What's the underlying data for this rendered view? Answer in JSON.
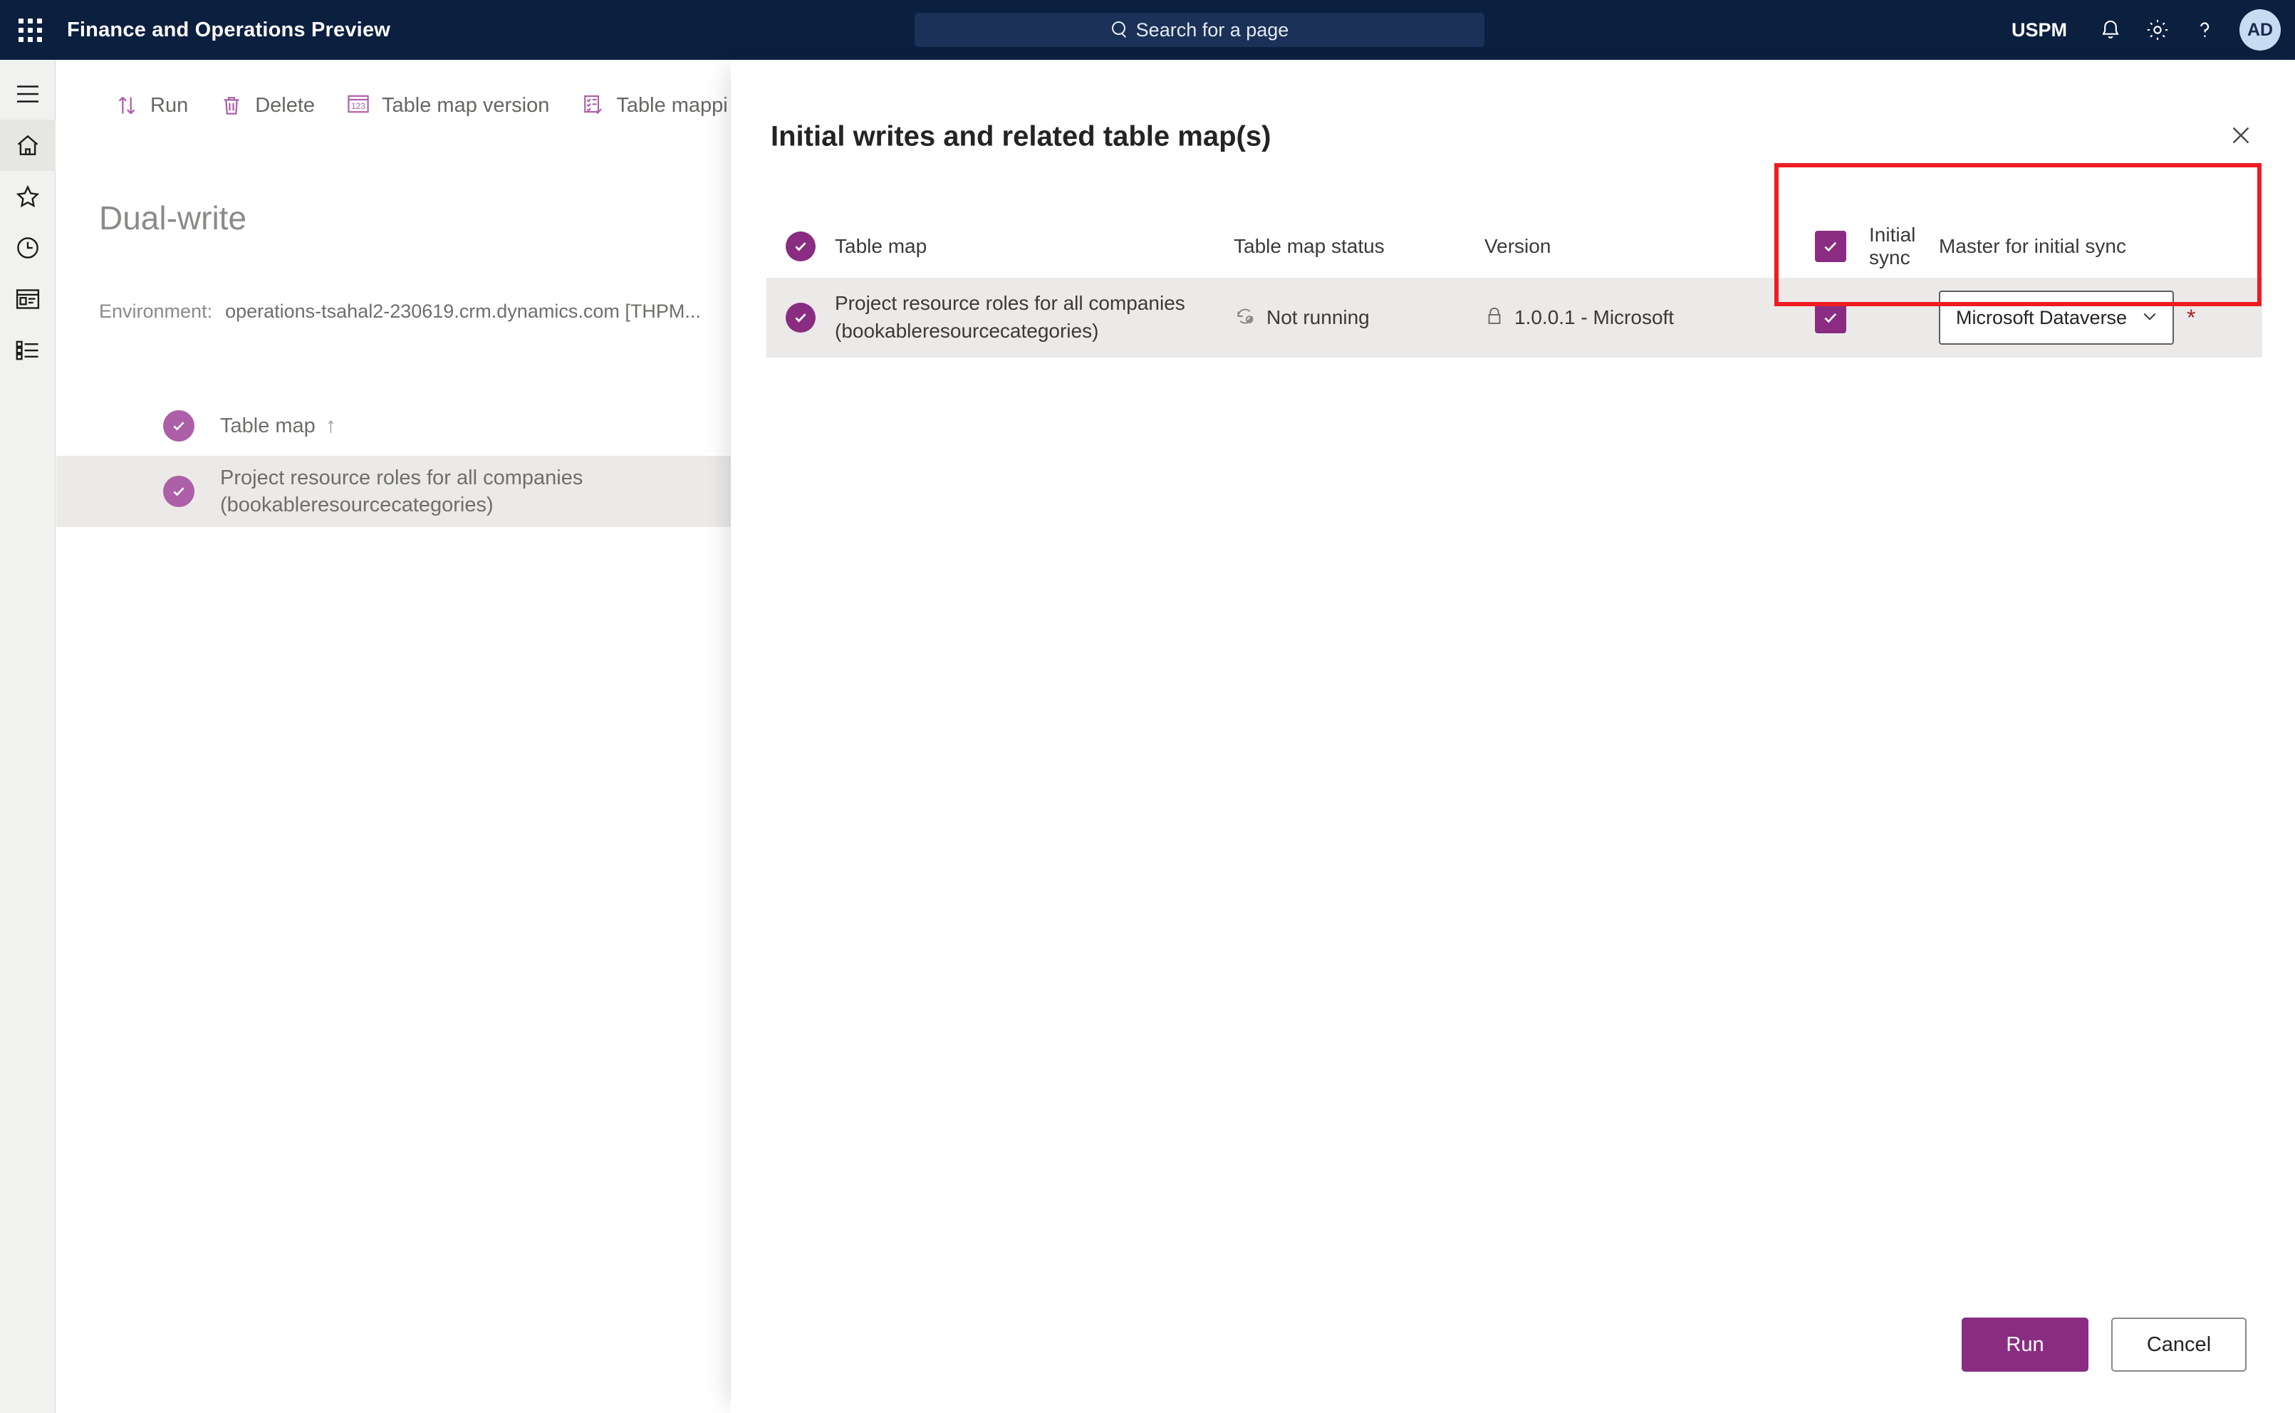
{
  "topnav": {
    "waffle": "app-launcher",
    "app_title": "Finance and Operations Preview",
    "search_placeholder": "Search for a page",
    "company": "USPM",
    "notifications_icon": "bell-icon",
    "settings_icon": "gear-icon",
    "help_icon": "question-mark-icon",
    "avatar_initials": "AD"
  },
  "rail": {
    "items": [
      {
        "name": "hamburger-menu",
        "label": "Expand navigation"
      },
      {
        "name": "home",
        "label": "Home"
      },
      {
        "name": "favorites",
        "label": "Favorites"
      },
      {
        "name": "recent",
        "label": "Recent"
      },
      {
        "name": "workspaces",
        "label": "Workspaces"
      },
      {
        "name": "modules",
        "label": "Modules"
      }
    ]
  },
  "toolbar": {
    "items": [
      {
        "icon": "run-arrows-icon",
        "label": "Run"
      },
      {
        "icon": "trash-icon",
        "label": "Delete"
      },
      {
        "icon": "number-123-icon",
        "label": "Table map version"
      },
      {
        "icon": "checklist-icon",
        "label": "Table mappi"
      }
    ]
  },
  "page": {
    "title": "Dual-write",
    "environment_label": "Environment:",
    "environment_value": "operations-tsahal2-230619.crm.dynamics.com [THPM..."
  },
  "background_grid": {
    "header": {
      "label": "Table map",
      "sort": "↑"
    },
    "rows": [
      {
        "line1": "Project resource roles for all companies",
        "line2": "(bookableresourcecategories)",
        "selected": true
      }
    ]
  },
  "panel": {
    "title": "Initial writes and related table map(s)",
    "close_icon": "close-icon",
    "columns": {
      "table_map": "Table map",
      "table_map_status": "Table map status",
      "version": "Version",
      "initial_sync": "Initial sync",
      "master_for_initial_sync": "Master for initial sync"
    },
    "rows": [
      {
        "selected": true,
        "table_map_line1": "Project resource roles for all companies",
        "table_map_line2": "(bookableresourcecategories)",
        "status_icon": "sync-disabled-icon",
        "status": "Not running",
        "version_icon": "lock-icon",
        "version": "1.0.0.1 - Microsoft",
        "initial_sync_checked": true,
        "master_value": "Microsoft Dataverse",
        "master_required_marker": "*"
      }
    ],
    "header_initial_sync_checked": true,
    "footer": {
      "primary": "Run",
      "secondary": "Cancel"
    }
  },
  "highlight": {
    "name": "red-highlight-box",
    "color": "#ef1c24"
  },
  "colors": {
    "nav_background": "#0b1f3f",
    "accent_purple": "#8a2d82",
    "soft_purple": "#ad5fa8",
    "row_selected": "#eceae8",
    "rail_background": "#f1f1ef",
    "required_red": "#a4262c",
    "highlight_red": "#ef1c24"
  }
}
